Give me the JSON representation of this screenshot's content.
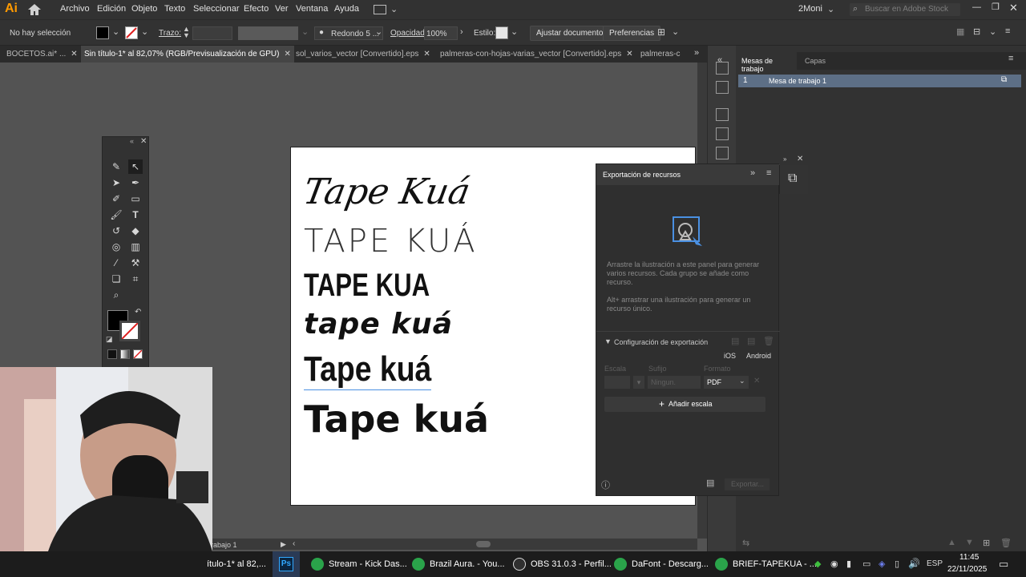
{
  "app": {
    "logo": "Ai"
  },
  "menu": [
    "Archivo",
    "Edición",
    "Objeto",
    "Texto",
    "Seleccionar",
    "Efecto",
    "Ver",
    "Ventana",
    "Ayuda"
  ],
  "workspace_name": "2Moni",
  "search_placeholder": "Buscar en Adobe Stock",
  "control": {
    "selection": "No hay selección",
    "stroke_label": "Trazo:",
    "brush": "Redondo 5 ...",
    "opacity_label": "Opacidad:",
    "opacity_value": "100%",
    "style_label": "Estilo:",
    "adjust_doc": "Ajustar documento",
    "prefs": "Preferencias"
  },
  "tabs": [
    {
      "label": "BOCETOS.ai* ..."
    },
    {
      "label": "Sin título-1* al 82,07% (RGB/Previsualización de GPU)"
    },
    {
      "label": "sol_varios_vector [Convertido].eps"
    },
    {
      "label": "palmeras-con-hojas-varias_vector [Convertido].eps"
    },
    {
      "label": "palmeras-c"
    }
  ],
  "artboard_samples": [
    "Tape Kuá",
    "TAPE KUÁ",
    "TAPE KUA",
    "tape kuá",
    "Tape kuá",
    "Tape kuá"
  ],
  "mesas_panel": {
    "tab1": "Mesas de trabajo",
    "tab2": "Capas",
    "row_num": "1",
    "row_name": "Mesa de trabajo 1"
  },
  "export_panel": {
    "title": "Exportación de recursos",
    "help1": "Arrastre la ilustración a este panel para generar varios recursos. Cada grupo se añade como recurso.",
    "help2": "Alt+ arrastrar una ilustración para generar un recurso único.",
    "config": "Configuración de exportación",
    "ios": "iOS",
    "android": "Android",
    "col_scale": "Escala",
    "col_suffix": "Sufijo",
    "col_format": "Formato",
    "suffix_placeholder": "Ningun.",
    "format": "PDF",
    "add_scale": "Añadir escala",
    "export_btn": "Exportar..."
  },
  "status": {
    "artboard_label": "rabajo 1"
  },
  "taskbar": {
    "items": [
      "ítulo-1* al 82,...",
      "Stream - Kick Das...",
      "Brazil Aura. - You...",
      "OBS 31.0.3 - Perfil...",
      "DaFont - Descarg...",
      "BRIEF-TAPEKUA - ..."
    ],
    "lang": "ESP",
    "time": "11:45",
    "date": "22/11/2025"
  },
  "colors": {
    "accent_orange": "#ff9a00",
    "selection_blue": "#4a90e2"
  }
}
